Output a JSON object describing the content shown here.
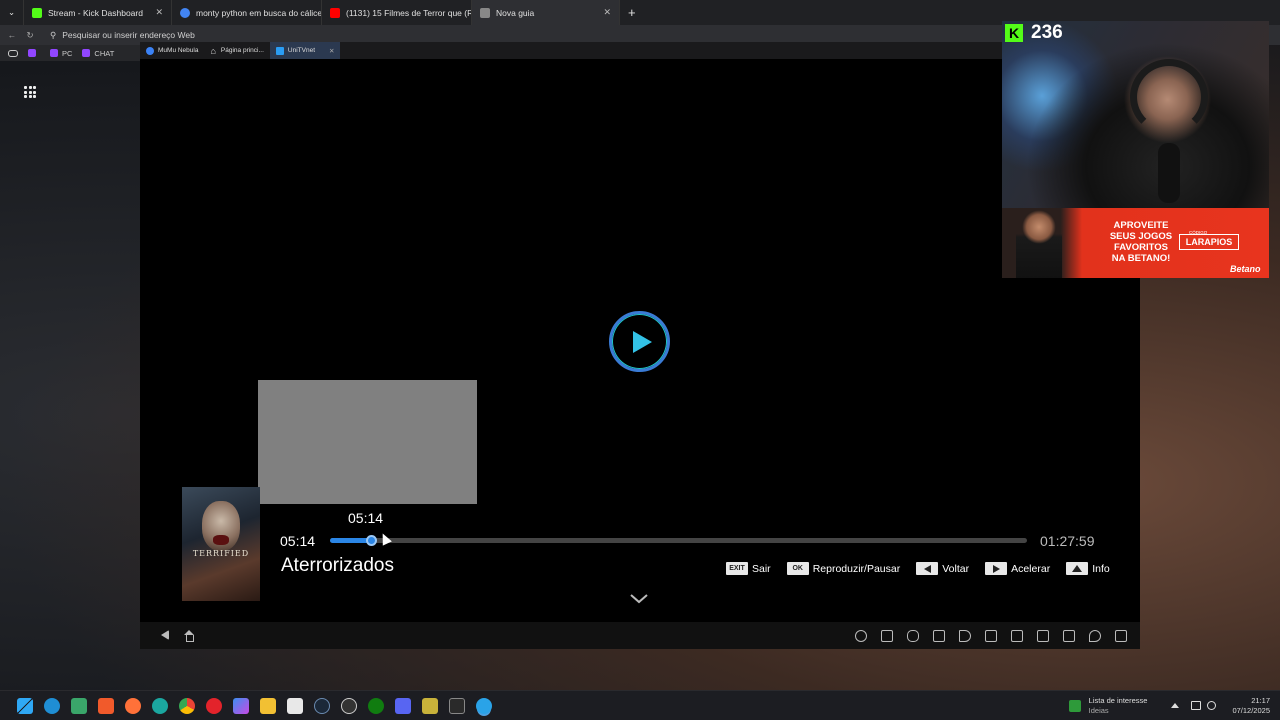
{
  "browser": {
    "tabs": [
      {
        "label": "Stream - Kick Dashboard",
        "color": "#53fc18"
      },
      {
        "label": "monty python em busca do cálice",
        "color": "#4285f4"
      },
      {
        "label": "(1131) 15 Filmes de Terror que (Re",
        "color": "#ff0000"
      },
      {
        "label": "Nova guia",
        "color": "#888888"
      }
    ],
    "address_placeholder": "Pesquisar ou inserir endereço Web",
    "bookmarks": [
      "PC",
      "CHAT"
    ]
  },
  "emulator": {
    "tabs": [
      {
        "label": "MuMu Nebula"
      },
      {
        "label": "Página princi..."
      },
      {
        "label": "UniTVnet"
      }
    ]
  },
  "player": {
    "hover_time": "05:14",
    "current_time": "05:14",
    "total_time": "01:27:59",
    "progress": 0.0604,
    "movie_title": "Aterrorizados",
    "poster_title": "TERRIFIED",
    "controls": [
      {
        "key": "EXIT",
        "label": "Sair"
      },
      {
        "key": "OK",
        "label": "Reproduzir/Pausar"
      },
      {
        "key": "left",
        "label": "Voltar"
      },
      {
        "key": "right",
        "label": "Acelerar"
      },
      {
        "key": "up",
        "label": "Info"
      }
    ],
    "accent_color": "#2b86e6"
  },
  "overlay": {
    "viewer_count": "236",
    "ad_text": "APROVEITE SEUS JOGOS FAVORITOS NA BETANO!",
    "ad_code_label": "CÓDIGO",
    "ad_code": "LARAPIOS",
    "ad_brand": "Betano"
  },
  "taskbar": {
    "news_title": "Lista de interesse",
    "news_sub": "Ideias",
    "time": "21:17",
    "date": "07/12/2025"
  }
}
